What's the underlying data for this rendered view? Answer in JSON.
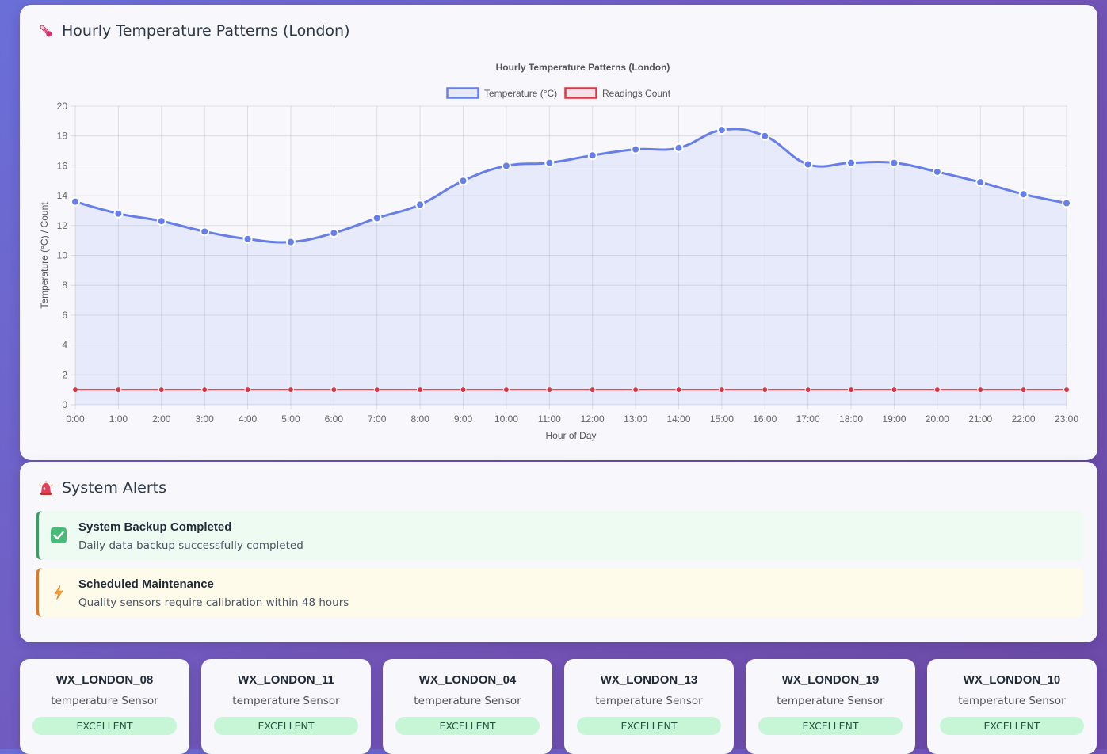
{
  "chart_card": {
    "header_title": "Hourly Temperature Patterns (London)",
    "header_icon": "thermometer-icon"
  },
  "chart_data": {
    "type": "line",
    "title": "Hourly Temperature Patterns (London)",
    "xlabel": "Hour of Day",
    "ylabel": "Temperature (°C) / Count",
    "categories": [
      "0:00",
      "1:00",
      "2:00",
      "3:00",
      "4:00",
      "5:00",
      "6:00",
      "7:00",
      "8:00",
      "9:00",
      "10:00",
      "11:00",
      "12:00",
      "13:00",
      "14:00",
      "15:00",
      "16:00",
      "17:00",
      "18:00",
      "19:00",
      "20:00",
      "21:00",
      "22:00",
      "23:00"
    ],
    "ylim": [
      0,
      20
    ],
    "yticks": [
      "0",
      "2",
      "4",
      "6",
      "8",
      "10",
      "12",
      "14",
      "16",
      "18",
      "20"
    ],
    "grid": true,
    "legend_position": "top-center",
    "series": [
      {
        "name": "Temperature (°C)",
        "color": "#667eea",
        "fill": "rgba(102,126,234,0.1)",
        "smooth": true,
        "filled": true,
        "values": [
          13.6,
          12.8,
          12.3,
          11.6,
          11.1,
          10.9,
          11.5,
          12.5,
          13.4,
          15.0,
          16.0,
          16.2,
          16.7,
          17.1,
          17.2,
          18.4,
          18.0,
          16.1,
          16.2,
          16.2,
          15.6,
          14.9,
          14.1,
          13.5
        ]
      },
      {
        "name": "Readings Count",
        "color": "#dc3545",
        "fill": "rgba(220,53,69,0.1)",
        "smooth": false,
        "filled": false,
        "values": [
          1,
          1,
          1,
          1,
          1,
          1,
          1,
          1,
          1,
          1,
          1,
          1,
          1,
          1,
          1,
          1,
          1,
          1,
          1,
          1,
          1,
          1,
          1,
          1
        ]
      }
    ]
  },
  "alerts_card": {
    "header_title": "System Alerts",
    "header_icon": "siren-icon",
    "alerts": [
      {
        "type": "success",
        "icon": "check-icon",
        "title": "System Backup Completed",
        "message": "Daily data backup successfully completed"
      },
      {
        "type": "warning",
        "icon": "lightning-icon",
        "title": "Scheduled Maintenance",
        "message": "Quality sensors require calibration within 48 hours"
      }
    ]
  },
  "sensors": [
    {
      "id": "WX_LONDON_08",
      "type": "temperature Sensor",
      "status": "EXCELLENT"
    },
    {
      "id": "WX_LONDON_11",
      "type": "temperature Sensor",
      "status": "EXCELLENT"
    },
    {
      "id": "WX_LONDON_04",
      "type": "temperature Sensor",
      "status": "EXCELLENT"
    },
    {
      "id": "WX_LONDON_13",
      "type": "temperature Sensor",
      "status": "EXCELLENT"
    },
    {
      "id": "WX_LONDON_19",
      "type": "temperature Sensor",
      "status": "EXCELLENT"
    },
    {
      "id": "WX_LONDON_10",
      "type": "temperature Sensor",
      "status": "EXCELLENT"
    }
  ]
}
